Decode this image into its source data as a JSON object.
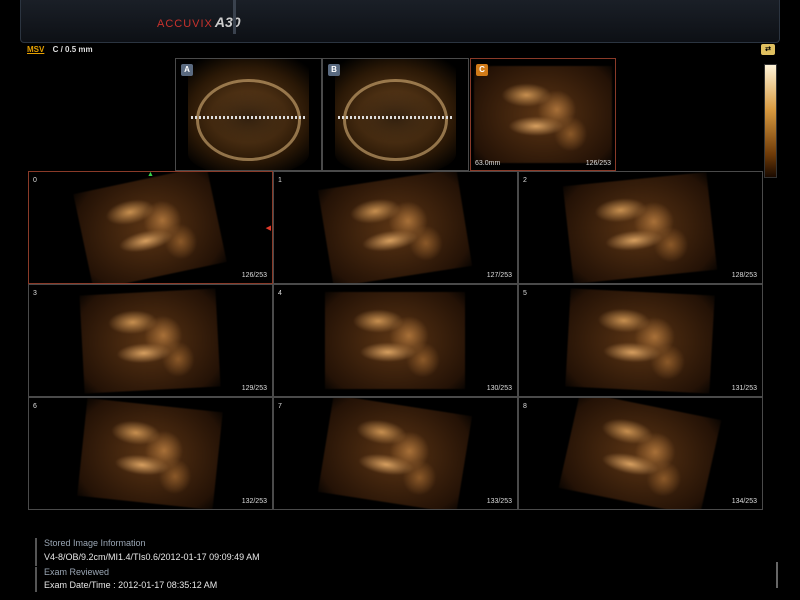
{
  "header": {
    "brand": "ACCUVIX",
    "model": "A30"
  },
  "mode": {
    "label": "MSV",
    "value": "C / 0.5 mm"
  },
  "reference_views": [
    {
      "letter": "A",
      "active": false
    },
    {
      "letter": "B",
      "active": false
    },
    {
      "letter": "C",
      "active": true,
      "depth": "63.0mm",
      "slice": "126/253"
    }
  ],
  "slices": [
    {
      "index": "0",
      "slice": "126/253",
      "selected": true
    },
    {
      "index": "1",
      "slice": "127/253"
    },
    {
      "index": "2",
      "slice": "128/253"
    },
    {
      "index": "3",
      "slice": "129/253"
    },
    {
      "index": "4",
      "slice": "130/253"
    },
    {
      "index": "5",
      "slice": "131/253"
    },
    {
      "index": "6",
      "slice": "132/253"
    },
    {
      "index": "7",
      "slice": "133/253"
    },
    {
      "index": "8",
      "slice": "134/253"
    }
  ],
  "info": {
    "stored_heading": "Stored Image Information",
    "stored_value": "V4-8/OB/9.2cm/MI1.4/TIs0.6/2012-01-17 09:09:49 AM",
    "exam_heading": "Exam Reviewed",
    "exam_value": "Exam Date/Time : 2012-01-17 08:35:12 AM"
  },
  "colors": {
    "brand_red": "#c8322d",
    "mode_amber": "#e6a000",
    "badge_c": "#d07a18",
    "marker_green": "#3ad24a",
    "marker_red": "#e03a2a"
  }
}
